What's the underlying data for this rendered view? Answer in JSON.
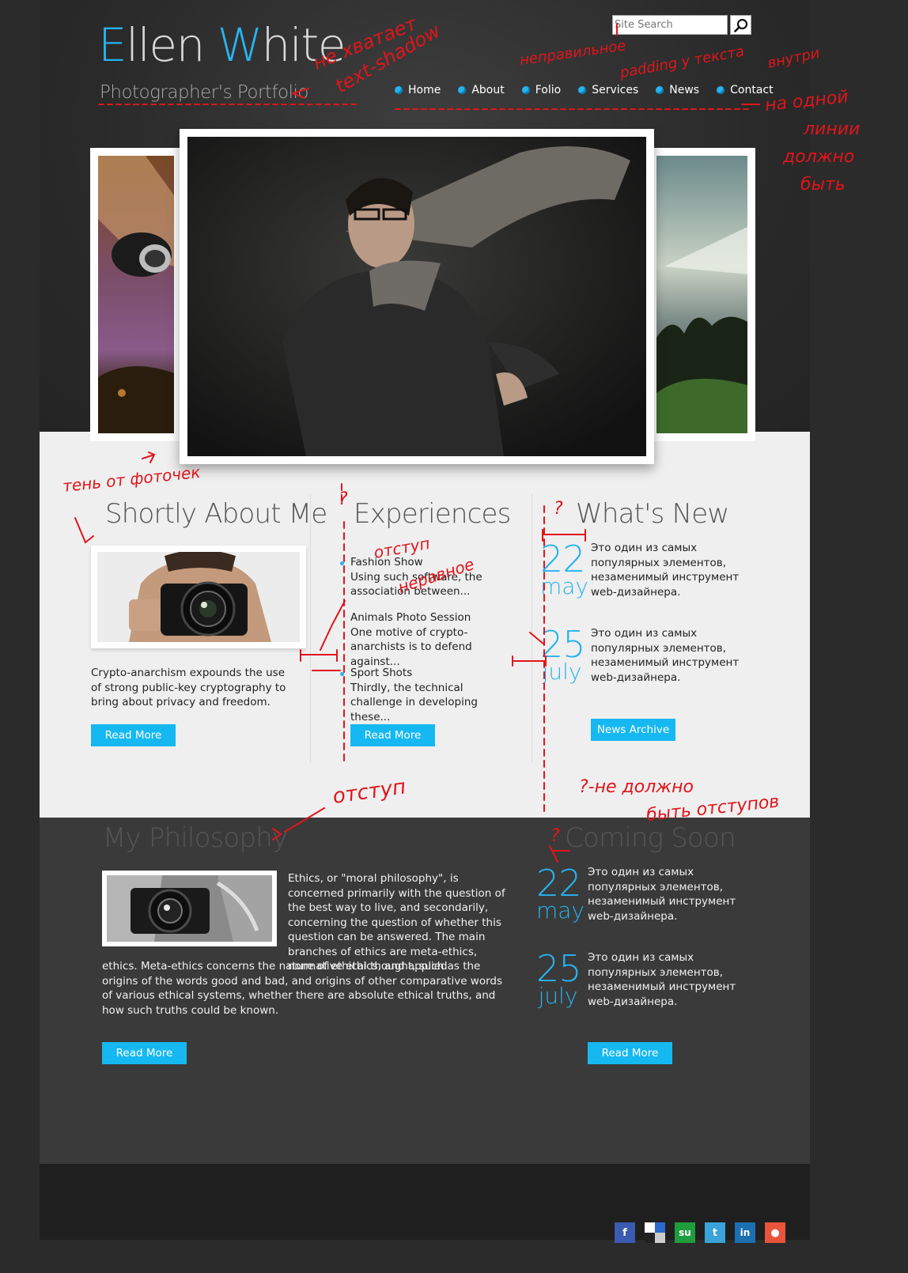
{
  "header": {
    "logo_first": "E",
    "logo_middle": "llen ",
    "logo_accent": "W",
    "logo_rest": "hite",
    "tagline": "Photographer's Portfolio",
    "search_placeholder": "Site Search"
  },
  "nav": {
    "items": [
      {
        "label": "Home"
      },
      {
        "label": "About"
      },
      {
        "label": "Folio"
      },
      {
        "label": "Services"
      },
      {
        "label": "News"
      },
      {
        "label": "Contact"
      }
    ]
  },
  "about": {
    "title": "Shortly About Me",
    "text": "Crypto-anarchism expounds the use of strong public-key cryptography to bring about privacy and freedom.",
    "button": "Read More"
  },
  "experiences": {
    "title": "Experiences",
    "items": [
      {
        "title": "Fashion Show",
        "text": "Using such software, the association between..."
      },
      {
        "title": "Animals Photo Session",
        "text": "One motive of crypto-anarchists is to defend against..."
      },
      {
        "title": "Sport Shots",
        "text": "Thirdly, the technical challenge in developing these..."
      }
    ],
    "button": "Read More"
  },
  "news": {
    "title": "What's New",
    "items": [
      {
        "day": "22",
        "month": "may",
        "text": "Это один из самых популярных элементов, незаменимый инструмент web-дизайнера."
      },
      {
        "day": "25",
        "month": "july",
        "text": "Это один из самых популярных элементов, незаменимый инструмент web-дизайнера."
      }
    ],
    "button": "News Archive"
  },
  "philosophy": {
    "title": "My Philosophy",
    "text": "Ethics, or \"moral philosophy\", is concerned primarily with the question of the best way to live, and secondarily, concerning the question of whether this question can be answered. The main branches of ethics are meta-ethics, normative ethics, and applied ethics. Meta-ethics concerns the nature of ethical thought, such as the origins of the words good and bad, and origins of other comparative words of various ethical systems, whether there are absolute ethical truths, and how such truths could be known.",
    "button": "Read More"
  },
  "coming": {
    "title": "Coming Soon",
    "items": [
      {
        "day": "22",
        "month": "may",
        "text": "Это один из самых популярных элементов, незаменимый инструмент web-дизайнера."
      },
      {
        "day": "25",
        "month": "july",
        "text": "Это один из самых популярных элементов, незаменимый инструмент web-дизайнера."
      }
    ],
    "button": "Read More"
  },
  "social": {
    "icons": [
      "facebook-icon",
      "delicious-icon",
      "stumbleupon-icon",
      "twitter-icon",
      "linkedin-icon",
      "reddit-icon"
    ]
  },
  "annotations": {
    "a1": "не хватает",
    "a2": "text-shadow",
    "a3": "неправильное",
    "a4": "padding у текста",
    "a5": "внутри",
    "a6": "на одной",
    "a7": "линии",
    "a8": "должно",
    "a9": "быть",
    "a10": "тень от фоточек",
    "a11": "отступ",
    "a12": "неравное",
    "a13": "отступ",
    "a14": "?-не должно",
    "a15": "быть отступов",
    "a16": "?",
    "a17": "?",
    "a18": "?"
  },
  "colors": {
    "accent": "#27b3ef",
    "button": "#16b8f2",
    "annotation": "#e0151b"
  }
}
